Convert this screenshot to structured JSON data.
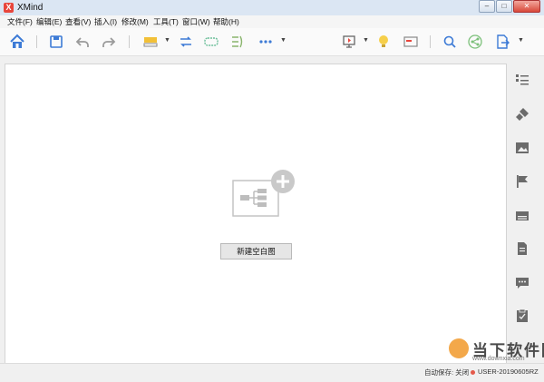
{
  "app": {
    "title": "XMind",
    "logo_letter": "X"
  },
  "window_controls": {
    "minimize": "–",
    "restore": "□",
    "close": "✕"
  },
  "menu": [
    {
      "label": "文件(F)"
    },
    {
      "label": "编辑(E)"
    },
    {
      "label": "查看(V)"
    },
    {
      "label": "插入(I)"
    },
    {
      "label": "修改(M)"
    },
    {
      "label": "工具(T)"
    },
    {
      "label": "窗口(W)"
    },
    {
      "label": "帮助(H)"
    }
  ],
  "toolbar": {
    "icons": [
      "home-icon",
      "save-icon",
      "undo-icon",
      "redo-icon",
      "topic-style-icon",
      "relationship-icon",
      "boundary-icon",
      "summary-icon",
      "more-icon",
      "presentation-icon",
      "idea-icon",
      "sheet-icon",
      "search-icon",
      "share-icon",
      "export-icon"
    ]
  },
  "canvas": {
    "new_blank_label": "新建空白图"
  },
  "sidepanel": {
    "icons": [
      "outline-icon",
      "format-brush-icon",
      "image-icon",
      "marker-flag-icon",
      "label-icon",
      "notes-icon",
      "comments-icon",
      "task-icon"
    ]
  },
  "status": {
    "autosave": "自动保存: 关闭",
    "user": "USER-20190605RZ"
  },
  "watermark": {
    "text": "当下软件园",
    "url": "www.downxia.com"
  },
  "colors": {
    "accent_blue": "#3d7bd6",
    "brand_red": "#e8463c",
    "icon_gray": "#6b6b6b"
  }
}
